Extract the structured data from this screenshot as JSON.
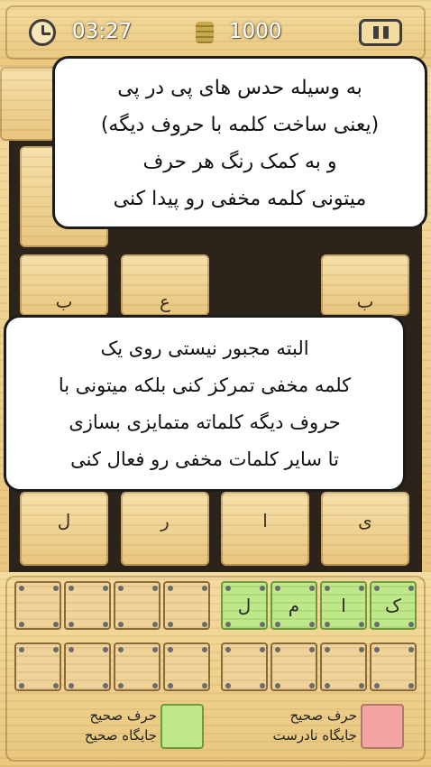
{
  "header": {
    "timer_icon": "clock-icon",
    "time": "03:27",
    "coin_icon": "coin-stack-icon",
    "coins": "1000",
    "pause_icon": "pause-icon"
  },
  "board": {
    "letters": [
      "ب",
      "ع",
      "ب",
      "ل",
      "ر",
      "ا",
      "ی"
    ]
  },
  "tutorial": {
    "bubble1": [
      "به وسیله حدس های پی در پی",
      "(یعنی ساخت کلمه با حروف دیگه)",
      "و به کمک رنگ هر حرف",
      "میتونی کلمه مخفی رو پیدا کنی"
    ],
    "bubble2": [
      "البته مجبور نیستی روی یک",
      "کلمه مخفی تمرکز کنی بلکه میتونی با",
      "حروف دیگه کلماته متمایزی بسازی",
      "تا سایر کلمات مخفی رو فعال کنی"
    ]
  },
  "tray": {
    "row1_letters": [
      "ک",
      "ا",
      "م",
      "ل"
    ],
    "colors": {
      "correct_place": "#bfe88a",
      "wrong_place": "#f4a3a3"
    }
  },
  "legend": {
    "green": {
      "line1": "حرف صحیح",
      "line2": "جایگاه صحیح"
    },
    "red": {
      "line1": "حرف صحیح",
      "line2": "جایگاه نادرست"
    }
  }
}
